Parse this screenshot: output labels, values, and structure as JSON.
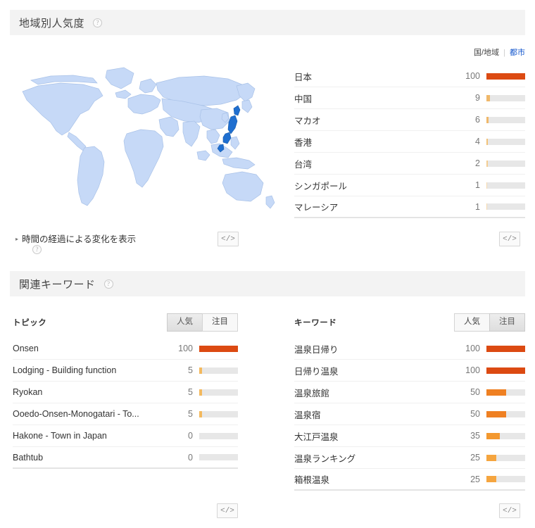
{
  "sections": {
    "geo": {
      "title": "地域別人気度",
      "help_label": "?",
      "toggle": {
        "country_label": "国/地域",
        "separator": "|",
        "city_label": "都市"
      },
      "time_change_label": "時間の経過による変化を表示",
      "time_change_caret": "▸",
      "embed_label": "</>",
      "map": {
        "highlighted_region": "日本",
        "base_color": "#c6d9f7",
        "highlight_color": "#1f6fd0",
        "outline_color": "#a9c2e8"
      }
    },
    "related": {
      "title": "関連キーワード",
      "help_label": "?"
    }
  },
  "chart_data": [
    {
      "type": "bar",
      "title": "地域別人気度",
      "orientation": "horizontal",
      "categories": [
        "日本",
        "中国",
        "マカオ",
        "香港",
        "台湾",
        "シンガポール",
        "マレーシア"
      ],
      "values": [
        100,
        9,
        6,
        4,
        2,
        1,
        1
      ],
      "ylim": [
        0,
        100
      ],
      "xlabel": "",
      "ylabel": "",
      "grid": false,
      "legend": "none",
      "bar_colors": [
        "#dc4a12",
        "#f0b86a",
        "#f0b86a",
        "#f2c277",
        "#f4cd92",
        "#f6d9ad",
        "#f6d9ad"
      ]
    },
    {
      "type": "bar",
      "title": "トピック",
      "orientation": "horizontal",
      "categories": [
        "Onsen",
        "Lodging - Building function",
        "Ryokan",
        "Ooedo-Onsen-Monogatari - To...",
        "Hakone - Town in Japan",
        "Bathtub"
      ],
      "values": [
        100,
        5,
        5,
        5,
        0,
        0
      ],
      "ylim": [
        0,
        100
      ],
      "xlabel": "",
      "ylabel": "",
      "grid": false,
      "legend": "none",
      "bar_colors": [
        "#dc4a12",
        "#f3b95e",
        "#f3b95e",
        "#f3b95e",
        "#e7e7e7",
        "#e7e7e7"
      ]
    },
    {
      "type": "bar",
      "title": "キーワード",
      "orientation": "horizontal",
      "categories": [
        "温泉日帰り",
        "日帰り温泉",
        "温泉旅館",
        "温泉宿",
        "大江戸温泉",
        "温泉ランキング",
        "箱根温泉"
      ],
      "values": [
        100,
        100,
        50,
        50,
        35,
        25,
        25
      ],
      "ylim": [
        0,
        100
      ],
      "xlabel": "",
      "ylabel": "",
      "grid": false,
      "legend": "none",
      "bar_colors": [
        "#dc4a12",
        "#dc4a12",
        "#ef8022",
        "#ef8022",
        "#f3982f",
        "#f5a53f",
        "#f5a53f"
      ]
    }
  ],
  "geo_list": {
    "rows": [
      {
        "label": "日本",
        "value": "100",
        "pct": 100,
        "color": "#dc4a12"
      },
      {
        "label": "中国",
        "value": "9",
        "pct": 9,
        "color": "#f0b86a"
      },
      {
        "label": "マカオ",
        "value": "6",
        "pct": 6,
        "color": "#f0b86a"
      },
      {
        "label": "香港",
        "value": "4",
        "pct": 4,
        "color": "#f2c277"
      },
      {
        "label": "台湾",
        "value": "2",
        "pct": 3,
        "color": "#f4cd92"
      },
      {
        "label": "シンガポール",
        "value": "1",
        "pct": 2,
        "color": "#f6d9ad"
      },
      {
        "label": "マレーシア",
        "value": "1",
        "pct": 2,
        "color": "#f6d9ad"
      }
    ]
  },
  "topics": {
    "col_title": "トピック",
    "tabs": [
      {
        "label": "人気",
        "selected": true
      },
      {
        "label": "注目",
        "selected": false
      }
    ],
    "embed_label": "</>",
    "rows": [
      {
        "label": "Onsen",
        "value": "100",
        "pct": 100,
        "color": "#dc4a12"
      },
      {
        "label": "Lodging - Building function",
        "value": "5",
        "pct": 7,
        "color": "#f3b95e"
      },
      {
        "label": "Ryokan",
        "value": "5",
        "pct": 7,
        "color": "#f3b95e"
      },
      {
        "label": "Ooedo-Onsen-Monogatari - To...",
        "value": "5",
        "pct": 7,
        "color": "#f3b95e"
      },
      {
        "label": "Hakone - Town in Japan",
        "value": "0",
        "pct": 0,
        "color": "#e7e7e7"
      },
      {
        "label": "Bathtub",
        "value": "0",
        "pct": 0,
        "color": "#e7e7e7"
      }
    ]
  },
  "keywords": {
    "col_title": "キーワード",
    "tabs": [
      {
        "label": "人気",
        "selected": false
      },
      {
        "label": "注目",
        "selected": true
      }
    ],
    "embed_label": "</>",
    "rows": [
      {
        "label": "温泉日帰り",
        "value": "100",
        "pct": 100,
        "color": "#dc4a12"
      },
      {
        "label": "日帰り温泉",
        "value": "100",
        "pct": 100,
        "color": "#dc4a12"
      },
      {
        "label": "温泉旅館",
        "value": "50",
        "pct": 50,
        "color": "#ef8022"
      },
      {
        "label": "温泉宿",
        "value": "50",
        "pct": 50,
        "color": "#ef8022"
      },
      {
        "label": "大江戸温泉",
        "value": "35",
        "pct": 35,
        "color": "#f3982f"
      },
      {
        "label": "温泉ランキング",
        "value": "25",
        "pct": 25,
        "color": "#f5a53f"
      },
      {
        "label": "箱根温泉",
        "value": "25",
        "pct": 25,
        "color": "#f5a53f"
      }
    ]
  }
}
